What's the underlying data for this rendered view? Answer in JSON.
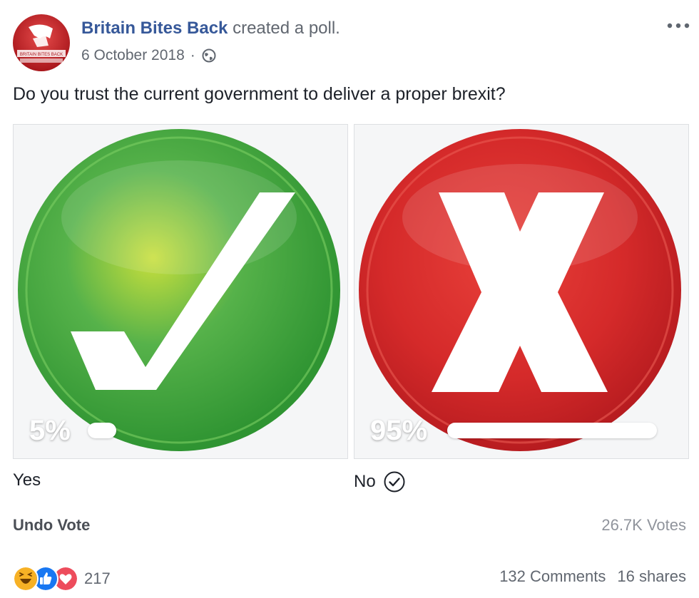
{
  "post": {
    "author": "Britain Bites Back",
    "action": "created a poll.",
    "date": "6 October 2018",
    "separator": "·",
    "privacy_icon": "globe-icon",
    "avatar_text": "BRITAIN BITES BACK",
    "question": "Do you trust the current government to deliver a proper brexit?"
  },
  "poll": {
    "options": [
      {
        "label": "Yes",
        "percent_label": "5%",
        "percent": 5,
        "icon": "checkmark-icon",
        "color": "#3fa63a"
      },
      {
        "label": "No",
        "percent_label": "95%",
        "percent": 95,
        "icon": "cross-icon",
        "color": "#d52a2a",
        "voted": true
      }
    ],
    "undo_label": "Undo Vote",
    "votes_label": "26.7K Votes"
  },
  "footer": {
    "reactions": [
      "haha-icon",
      "like-icon",
      "love-icon"
    ],
    "reaction_count": "217",
    "comments": "132 Comments",
    "shares": "16 shares"
  }
}
